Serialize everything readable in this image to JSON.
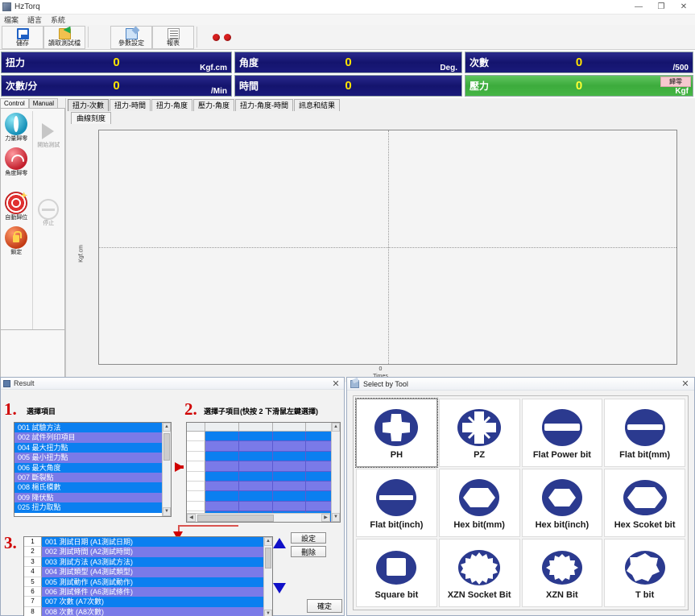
{
  "app": {
    "title": "HzTorq",
    "window_buttons": {
      "minimize": "—",
      "maximize": "❐",
      "close": "✕"
    },
    "menu": [
      {
        "label": "檔案"
      },
      {
        "label": "語言"
      },
      {
        "label": "系統"
      }
    ],
    "toolbar": [
      {
        "icon": "save-icon",
        "label": "儲存"
      },
      {
        "icon": "folder-icon",
        "label": "讀取測試檔"
      },
      {
        "icon": "param-icon",
        "label": "參數設定"
      },
      {
        "icon": "report-icon",
        "label": "報表"
      }
    ],
    "status_leds": 2
  },
  "readouts": [
    {
      "label": "扭力",
      "value": "0",
      "unit": "Kgf.cm",
      "color": "#16166e",
      "badge": null
    },
    {
      "label": "角度",
      "value": "0",
      "unit": "Deg.",
      "color": "#16166e",
      "badge": null
    },
    {
      "label": "次數",
      "value": "0",
      "unit": "/500",
      "color": "#16166e",
      "badge": null
    },
    {
      "label": "次數/分",
      "value": "0",
      "unit": "/Min",
      "color": "#16166e",
      "badge": null
    },
    {
      "label": "時間",
      "value": "0",
      "unit": "",
      "color": "#16166e",
      "badge": null
    },
    {
      "label": "壓力",
      "value": "0",
      "unit": "Kgf",
      "color": "#3cab3c",
      "badge": "歸零"
    }
  ],
  "control_panel": {
    "tabs": [
      {
        "label": "Control",
        "active": true
      },
      {
        "label": "Manual",
        "active": false
      }
    ],
    "buttons": [
      {
        "icon": "force-zero-icon",
        "label": "力量歸零",
        "enabled": true,
        "col": "left"
      },
      {
        "icon": "angle-zero-icon",
        "label": "角度歸零",
        "enabled": true,
        "col": "left"
      },
      {
        "icon": "auto-home-icon",
        "label": "自動歸位",
        "enabled": true,
        "col": "left"
      },
      {
        "icon": "lock-icon",
        "label": "鎖定",
        "enabled": true,
        "col": "left"
      },
      {
        "icon": "play-icon",
        "label": "開始測試",
        "enabled": false,
        "col": "right"
      },
      {
        "icon": "stop-icon",
        "label": "停止",
        "enabled": false,
        "col": "right"
      }
    ]
  },
  "chart": {
    "tabs": [
      {
        "label": "扭力-次數",
        "active": true
      },
      {
        "label": "扭力-時間",
        "active": false
      },
      {
        "label": "扭力-角度",
        "active": false
      },
      {
        "label": "壓力-角度",
        "active": false
      },
      {
        "label": "扭力-角度-時間",
        "active": false
      },
      {
        "label": "訊息和結果",
        "active": false
      }
    ],
    "subtabs": [
      {
        "label": "曲線刻度",
        "active": true
      }
    ]
  },
  "chart_data": {
    "type": "line",
    "title": "",
    "xlabel": "Times",
    "ylabel": "Kgf.cm",
    "xticks": [
      "0"
    ],
    "yticks": [],
    "grid": false,
    "legend": [],
    "series": [
      {
        "name": "扭力-次數",
        "x": [],
        "y": []
      }
    ],
    "note": "empty plot, no data plotted"
  },
  "result_dialog": {
    "title": "Result",
    "close_label": "✕",
    "sections": [
      {
        "number": "1.",
        "title": "選擇項目"
      },
      {
        "number": "2.",
        "title": "選擇子項目(快按 2 下滑鼠左鍵選擇)"
      },
      {
        "number": "3.",
        "title": ""
      }
    ],
    "item_list": [
      "001 試驗方法",
      "002 試件列印項目",
      "004 最大扭力點",
      "005 最小扭力點",
      "006 最大角度",
      "007 斷裂點",
      "008 楊氏模數",
      "009 降伏點",
      "025 扭力取點"
    ],
    "subitem_grid": {
      "columns": 4,
      "rows": 12,
      "cells_empty": true
    },
    "selected_list": [
      {
        "no": "1",
        "text": "001 測試日期 (A1測試日期)"
      },
      {
        "no": "2",
        "text": "002 測試時間 (A2測試時間)"
      },
      {
        "no": "3",
        "text": "003 測試方法 (A3測試方法)"
      },
      {
        "no": "4",
        "text": "004 測試類型 (A4測試類型)"
      },
      {
        "no": "5",
        "text": "005 測試動作 (A5測試動作)"
      },
      {
        "no": "6",
        "text": "006 測試條件 (A6測試條件)"
      },
      {
        "no": "7",
        "text": "007 次數 (A7次數)"
      },
      {
        "no": "8",
        "text": "008 次數 (A8次數)"
      }
    ],
    "buttons": {
      "set": "設定",
      "delete": "刪除",
      "ok": "確定"
    },
    "spinner": {
      "up": "up-arrow-icon",
      "down": "down-arrow-icon"
    }
  },
  "tool_dialog": {
    "title": "Select by Tool",
    "close_label": "✕",
    "tools": [
      {
        "label": "PH",
        "icon": "phillips-bit-icon",
        "selected": true
      },
      {
        "label": "PZ",
        "icon": "pozidriv-bit-icon",
        "selected": false
      },
      {
        "label": "Flat Power bit",
        "icon": "flat-power-bit-icon",
        "selected": false
      },
      {
        "label": "Flat bit(mm)",
        "icon": "flat-bit-mm-icon",
        "selected": false
      },
      {
        "label": "Flat bit(inch)",
        "icon": "flat-bit-inch-icon",
        "selected": false
      },
      {
        "label": "Hex bit(mm)",
        "icon": "hex-bit-mm-icon",
        "selected": false
      },
      {
        "label": "Hex bit(inch)",
        "icon": "hex-bit-inch-icon",
        "selected": false
      },
      {
        "label": "Hex Scoket bit",
        "icon": "hex-socket-bit-icon",
        "selected": false
      },
      {
        "label": "Square bit",
        "icon": "square-bit-icon",
        "selected": false
      },
      {
        "label": "XZN Socket Bit",
        "icon": "xzn-socket-bit-icon",
        "selected": false
      },
      {
        "label": "XZN Bit",
        "icon": "xzn-bit-icon",
        "selected": false
      },
      {
        "label": "T bit",
        "icon": "t-bit-icon",
        "selected": false
      }
    ],
    "icon_color": "#2b3a8f"
  }
}
